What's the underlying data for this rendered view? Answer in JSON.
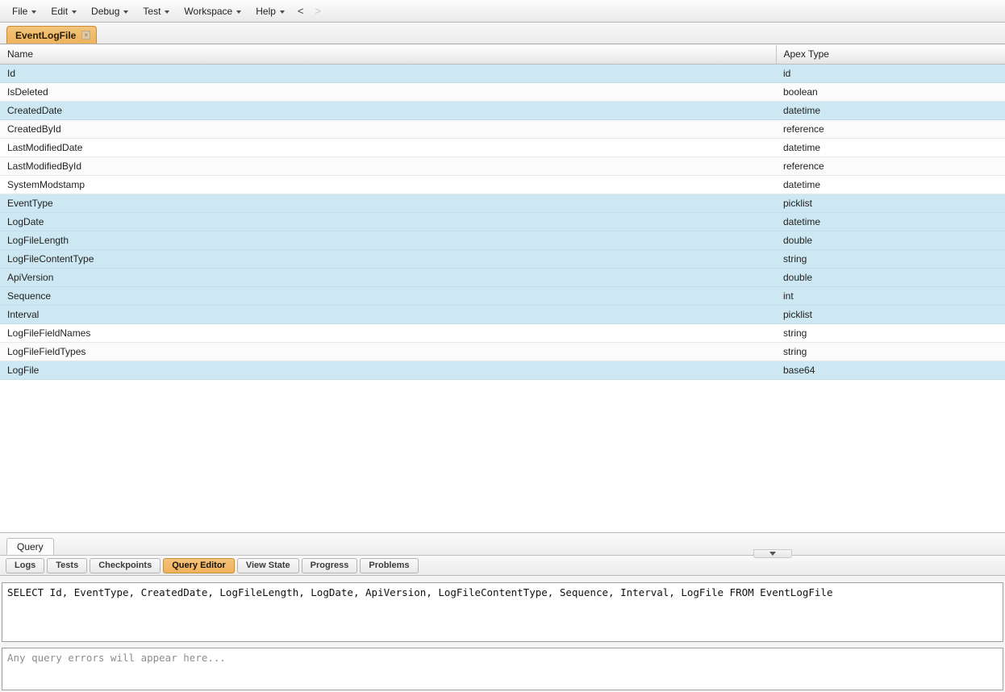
{
  "menubar": {
    "items": [
      {
        "label": "File",
        "has_caret": true
      },
      {
        "label": "Edit",
        "has_caret": true
      },
      {
        "label": "Debug",
        "has_caret": true
      },
      {
        "label": "Test",
        "has_caret": true
      },
      {
        "label": "Workspace",
        "has_caret": true
      },
      {
        "label": "Help",
        "has_caret": true
      }
    ],
    "nav_back": "<",
    "nav_forward": ">"
  },
  "object_tab": {
    "label": "EventLogFile",
    "close_glyph": "×"
  },
  "schema_table": {
    "columns": [
      "Name",
      "Apex Type"
    ],
    "rows": [
      {
        "name": "Id",
        "type": "id",
        "selected": true
      },
      {
        "name": "IsDeleted",
        "type": "boolean",
        "selected": false
      },
      {
        "name": "CreatedDate",
        "type": "datetime",
        "selected": true
      },
      {
        "name": "CreatedById",
        "type": "reference",
        "selected": false
      },
      {
        "name": "LastModifiedDate",
        "type": "datetime",
        "selected": false
      },
      {
        "name": "LastModifiedById",
        "type": "reference",
        "selected": false
      },
      {
        "name": "SystemModstamp",
        "type": "datetime",
        "selected": false
      },
      {
        "name": "EventType",
        "type": "picklist",
        "selected": true
      },
      {
        "name": "LogDate",
        "type": "datetime",
        "selected": true
      },
      {
        "name": "LogFileLength",
        "type": "double",
        "selected": true
      },
      {
        "name": "LogFileContentType",
        "type": "string",
        "selected": true
      },
      {
        "name": "ApiVersion",
        "type": "double",
        "selected": true
      },
      {
        "name": "Sequence",
        "type": "int",
        "selected": true
      },
      {
        "name": "Interval",
        "type": "picklist",
        "selected": true
      },
      {
        "name": "LogFileFieldNames",
        "type": "string",
        "selected": false
      },
      {
        "name": "LogFileFieldTypes",
        "type": "string",
        "selected": false
      },
      {
        "name": "LogFile",
        "type": "base64",
        "selected": true
      }
    ]
  },
  "lower_pane": {
    "query_tab_label": "Query",
    "splitter_icon": "chevron-down-icon"
  },
  "view_tabs": {
    "items": [
      {
        "label": "Logs",
        "active": false
      },
      {
        "label": "Tests",
        "active": false
      },
      {
        "label": "Checkpoints",
        "active": false
      },
      {
        "label": "Query Editor",
        "active": true
      },
      {
        "label": "View State",
        "active": false
      },
      {
        "label": "Progress",
        "active": false
      },
      {
        "label": "Problems",
        "active": false
      }
    ]
  },
  "query_editor": {
    "value": "SELECT Id, EventType, CreatedDate, LogFileLength, LogDate, ApiVersion, LogFileContentType, Sequence, Interval, LogFile FROM EventLogFile"
  },
  "error_panel": {
    "placeholder": "Any query errors will appear here..."
  },
  "colors": {
    "accent_orange": "#efb25b",
    "row_selected": "#cde8f2",
    "chrome": "#ededed"
  }
}
